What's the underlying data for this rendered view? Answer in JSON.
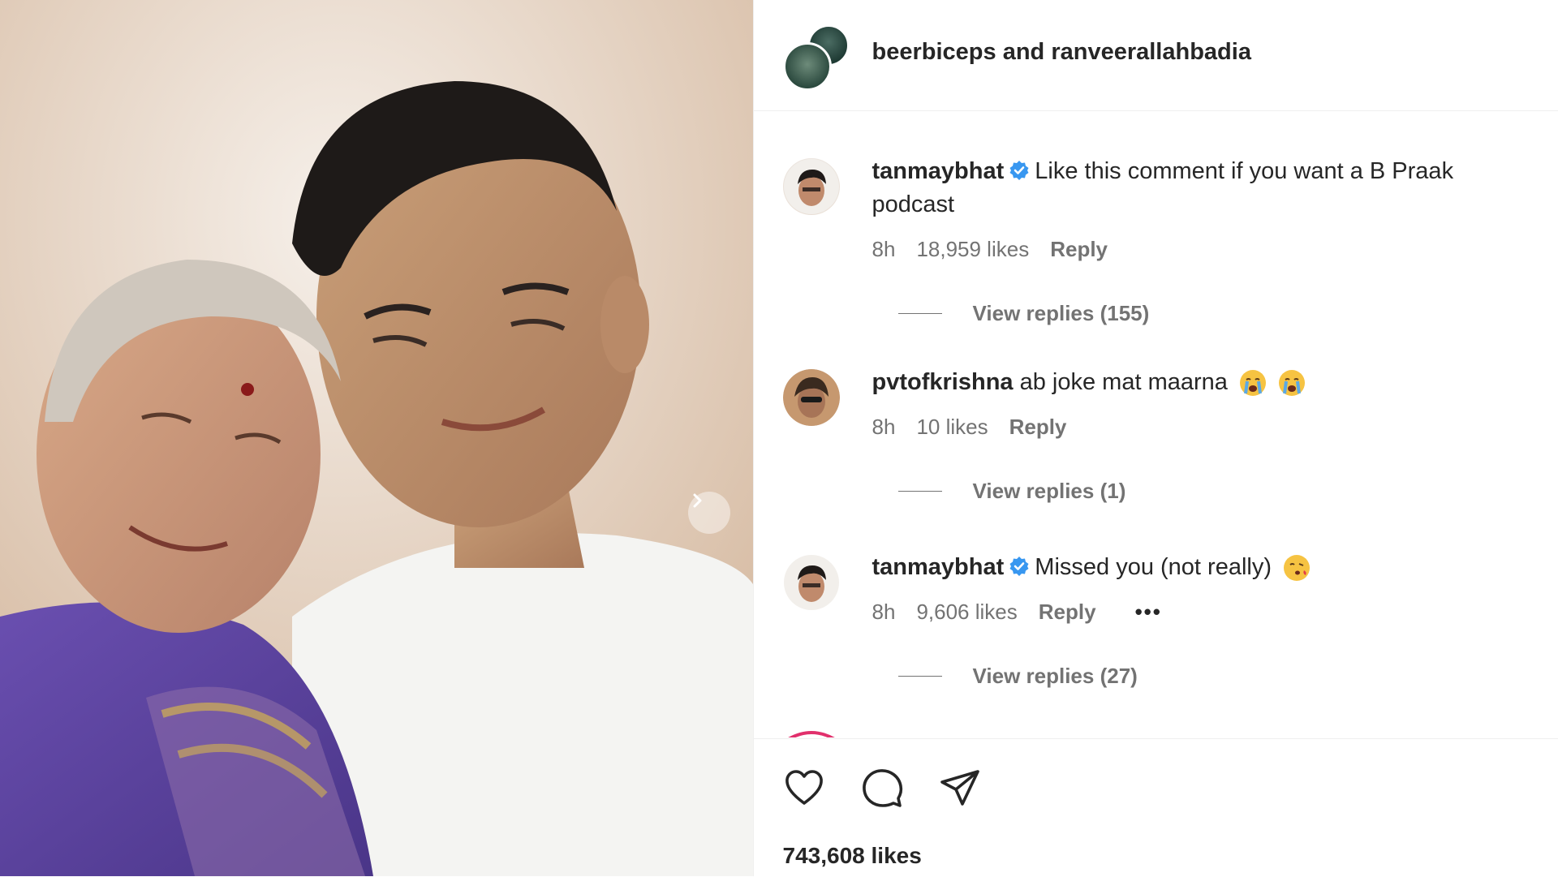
{
  "post": {
    "authors": "beerbiceps and ranveerallahbadia",
    "total_likes": "743,608 likes"
  },
  "comments": [
    {
      "username": "tanmaybhat",
      "verified": true,
      "text": "Like this comment if you want a B Praak podcast",
      "time": "8h",
      "likes": "18,959 likes",
      "reply_label": "Reply",
      "view_replies": "View replies (155)"
    },
    {
      "username": "pvtofkrishna",
      "verified": false,
      "text": "ab joke mat maarna",
      "time": "8h",
      "likes": "10 likes",
      "reply_label": "Reply",
      "view_replies": "View replies (1)"
    },
    {
      "username": "tanmaybhat",
      "verified": true,
      "text": "Missed you (not really)",
      "time": "8h",
      "likes": "9,606 likes",
      "reply_label": "Reply",
      "more": "•••",
      "view_replies": "View replies (27)"
    }
  ],
  "icons": {
    "like": "heart-icon",
    "comment": "comment-icon",
    "share": "share-icon",
    "next": "chevron-right-icon",
    "verified": "verified-badge-icon"
  },
  "colors": {
    "verified": "#3897f0",
    "muted": "#737373",
    "text": "#262626"
  }
}
